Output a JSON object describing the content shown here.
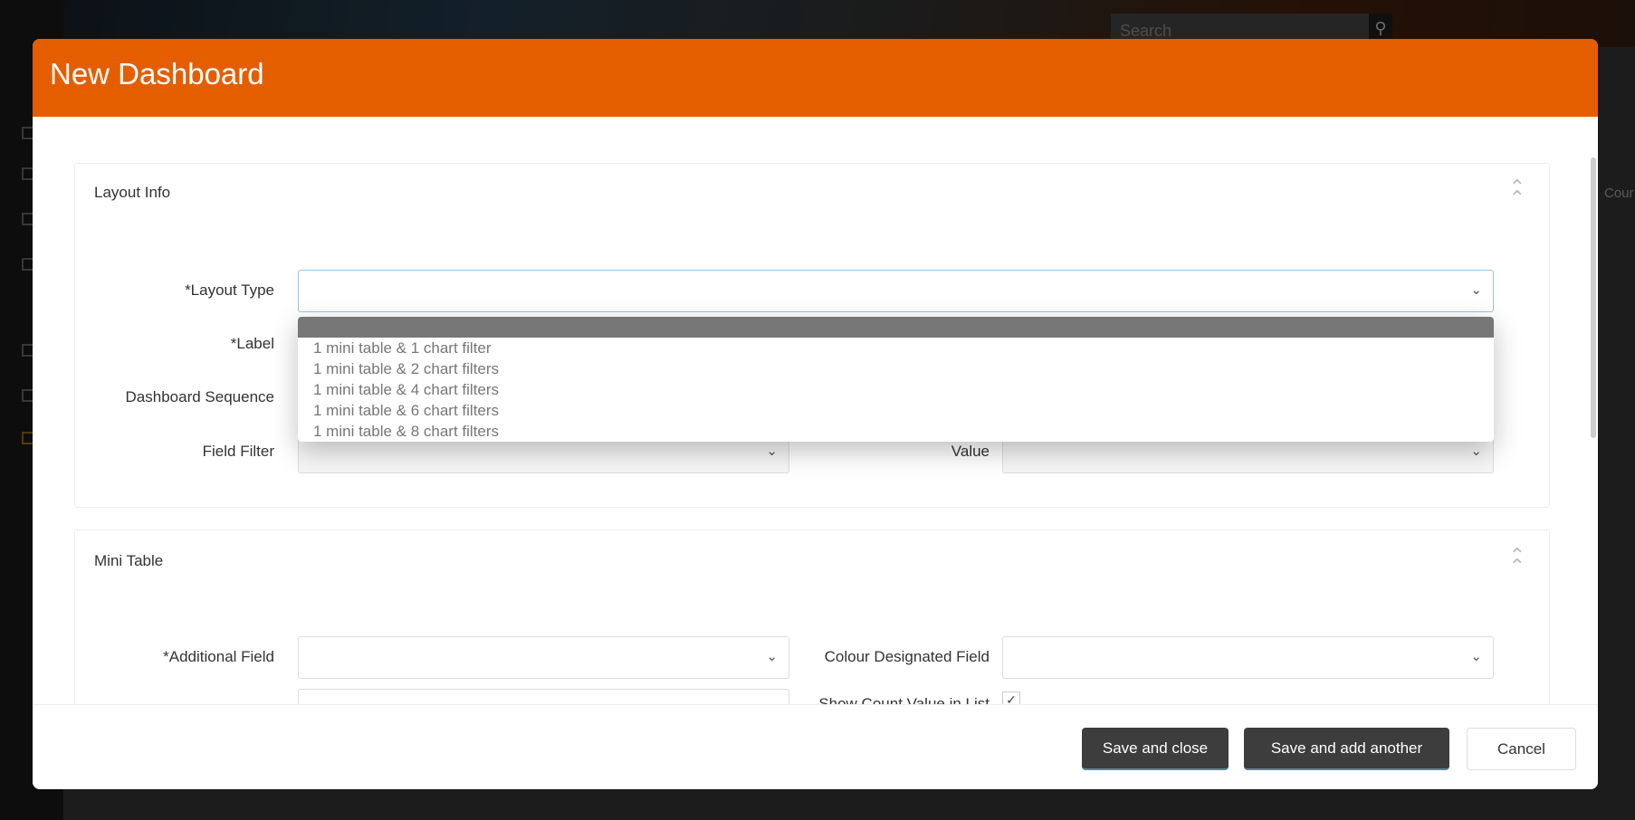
{
  "background": {
    "search_placeholder": "Search",
    "partial_text": "Cour"
  },
  "modal": {
    "title": "New Dashboard"
  },
  "layout_info": {
    "title": "Layout Info",
    "layout_type_label": "*Layout Type",
    "layout_type_value": "",
    "label_label": "*Label",
    "sequence_label": "Dashboard Sequence",
    "field_filter_label": "Field Filter",
    "value_label": "Value",
    "options": [
      "1 mini table & 1 chart filter",
      "1 mini table & 2 chart filters",
      "1 mini table & 4 chart filters",
      "1 mini table & 6 chart filters",
      "1 mini table & 8 chart filters"
    ]
  },
  "mini_table": {
    "title": "Mini Table",
    "additional_field_label": "*Additional Field",
    "colour_field_label": "Colour Designated Field",
    "show_count_label": "Show Count Value in List",
    "show_count_checked": true
  },
  "footer": {
    "save_close": "Save and close",
    "save_add": "Save and add another",
    "cancel": "Cancel"
  },
  "colors": {
    "header": "#e45e00",
    "button_dark": "#3d3d3d"
  }
}
